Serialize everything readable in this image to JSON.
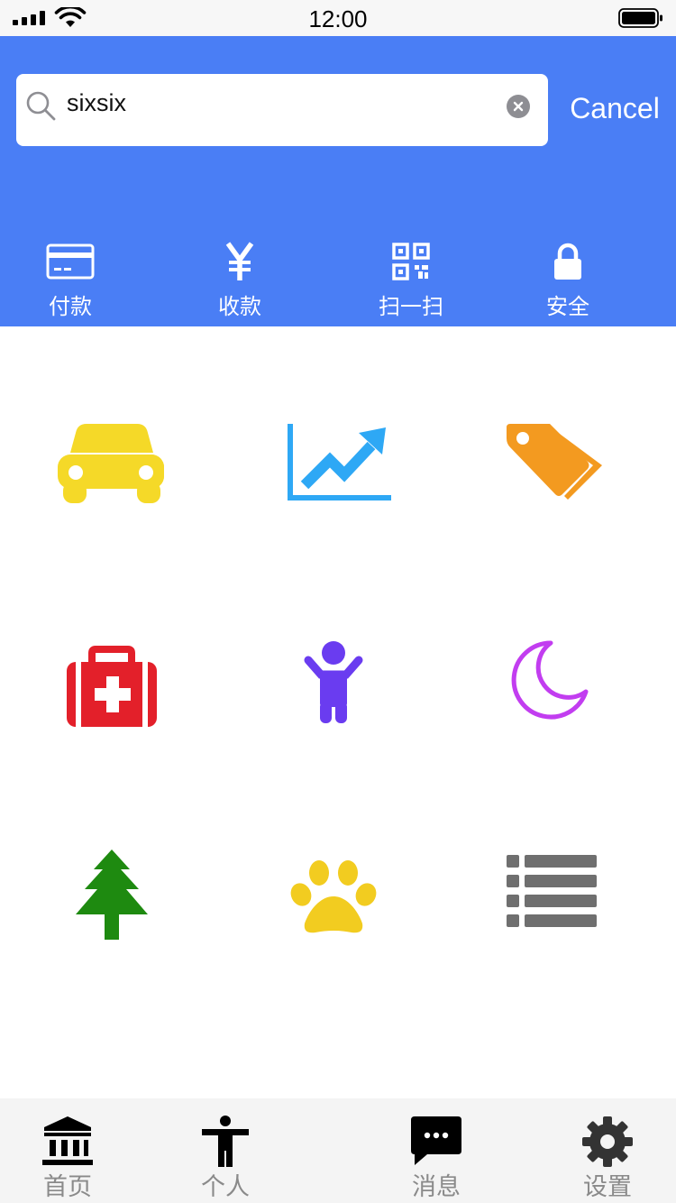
{
  "status_bar": {
    "time": "12:00",
    "signal_icon": "cellular-signal-icon",
    "wifi_icon": "wifi-icon",
    "battery_icon": "battery-icon"
  },
  "search": {
    "value": "sixsix",
    "placeholder": "",
    "search_icon": "search-icon",
    "clear_icon": "clear-icon",
    "cancel_label": "Cancel"
  },
  "colors": {
    "header_bg": "#4a7ef5",
    "tabbar_bg": "#f4f4f4",
    "tab_label": "#8a8a8a",
    "car": "#f5d928",
    "chart": "#2ea8f5",
    "tags": "#f39a20",
    "medical": "#e3202a",
    "person": "#6a3cf0",
    "moon": "#c23df0",
    "tree": "#1e8a10",
    "paw": "#f2cc20",
    "list": "#6f6f6f"
  },
  "quick_actions": [
    {
      "icon": "credit-card-icon",
      "label": "付款"
    },
    {
      "icon": "yen-icon",
      "label": "收款"
    },
    {
      "icon": "qr-code-icon",
      "label": "扫一扫"
    },
    {
      "icon": "lock-icon",
      "label": "安全"
    }
  ],
  "grid_items": [
    {
      "icon": "car-icon"
    },
    {
      "icon": "line-chart-icon"
    },
    {
      "icon": "tags-icon"
    },
    {
      "icon": "medical-kit-icon"
    },
    {
      "icon": "person-icon"
    },
    {
      "icon": "moon-icon"
    },
    {
      "icon": "tree-icon"
    },
    {
      "icon": "paw-icon"
    },
    {
      "icon": "list-icon"
    }
  ],
  "tabs": [
    {
      "icon": "bank-icon",
      "label": "首页"
    },
    {
      "icon": "accessibility-icon",
      "label": "个人"
    },
    {
      "icon": "chat-bubble-icon",
      "label": "消息"
    },
    {
      "icon": "gear-icon",
      "label": "设置"
    }
  ]
}
